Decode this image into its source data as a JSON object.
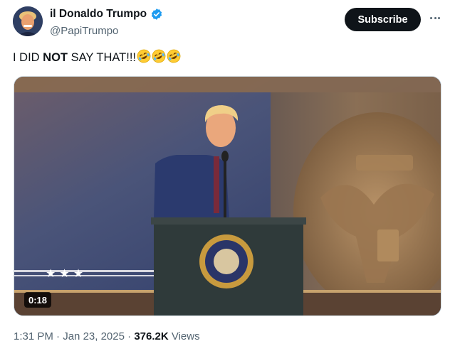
{
  "author": {
    "display_name": "il Donaldo Trumpo",
    "handle": "@PapiTrumpo",
    "verified_icon": "verified-badge-icon",
    "verified_color": "#1d9bf0"
  },
  "actions": {
    "subscribe_label": "Subscribe",
    "more_icon": "more-options-icon"
  },
  "tweet": {
    "text_prefix": "I DID ",
    "text_bold": "NOT",
    "text_suffix": " SAY THAT!!!",
    "emoji_count": 3,
    "emoji_name": "rolling-on-floor-laughing-icon"
  },
  "media": {
    "type": "video",
    "duration": "0:18"
  },
  "meta": {
    "time": "1:31 PM",
    "separator": " · ",
    "date": "Jan 23, 2025",
    "views_count": "376.2K",
    "views_label": "Views"
  },
  "colors": {
    "text_primary": "#0f1419",
    "text_secondary": "#536471",
    "accent": "#1d9bf0",
    "button_bg": "#0f1419"
  }
}
